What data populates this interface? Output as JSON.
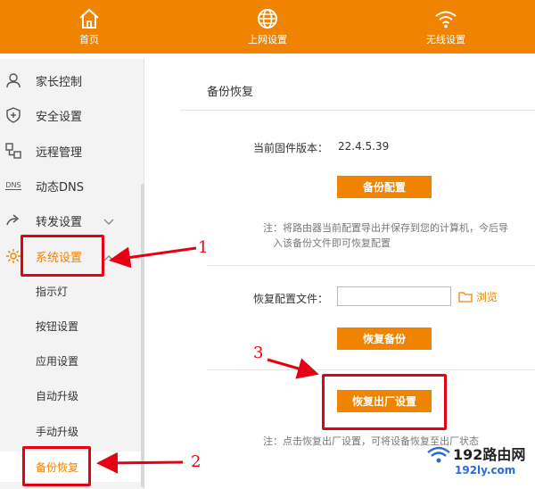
{
  "topnav": {
    "items": [
      {
        "label": "首页",
        "icon": "home-icon"
      },
      {
        "label": "上网设置",
        "icon": "globe-icon"
      },
      {
        "label": "无线设置",
        "icon": "wifi-icon"
      }
    ]
  },
  "sidebar": {
    "items": [
      {
        "label": "家长控制",
        "icon": "user-icon"
      },
      {
        "label": "安全设置",
        "icon": "shield-icon"
      },
      {
        "label": "远程管理",
        "icon": "remote-icon"
      },
      {
        "label": "动态DNS",
        "icon": "dns-icon",
        "icon_text": "DNS"
      },
      {
        "label": "转发设置",
        "icon": "forward-icon"
      },
      {
        "label": "系统设置",
        "icon": "gear-icon"
      }
    ],
    "sub_items": [
      {
        "label": "指示灯"
      },
      {
        "label": "按钮设置"
      },
      {
        "label": "应用设置"
      },
      {
        "label": "自动升级"
      },
      {
        "label": "手动升级"
      },
      {
        "label": "备份恢复",
        "active": true
      }
    ]
  },
  "main": {
    "title": "备份恢复",
    "firmware_label": "当前固件版本：",
    "firmware_value": "22.4.5.39",
    "backup_button": "备份配置",
    "backup_note_line1": "注：将路由器当前配置导出并保存到您的计算机，今后导",
    "backup_note_line2": "入该备份文件即可恢复配置",
    "restore_file_label": "恢复配置文件：",
    "restore_file_value": "",
    "browse_label": "浏览",
    "restore_button": "恢复备份",
    "factory_button": "恢复出厂设置",
    "factory_note": "注：点击恢复出厂设置，可将设备恢复至出厂状态"
  },
  "annotations": {
    "num1": "1",
    "num2": "2",
    "num3": "3",
    "color": "#e60012"
  },
  "watermark": {
    "top": "192路由网",
    "bottom": "192ly.com"
  },
  "colors": {
    "accent": "#f08300"
  }
}
